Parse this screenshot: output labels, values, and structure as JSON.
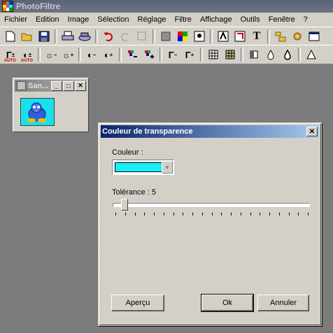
{
  "app": {
    "title": "PhotoFiltre"
  },
  "menu": [
    "Fichier",
    "Edition",
    "Image",
    "Sélection",
    "Réglage",
    "Filtre",
    "Affichage",
    "Outils",
    "Fenêtre",
    "?"
  ],
  "toolbar1": [
    "new-icon",
    "open-icon",
    "save-icon",
    "print-icon",
    "scan-icon",
    "undo-icon",
    "redo-icon",
    "selection-icon",
    "gray-icon",
    "colors-icon",
    "filter-a-icon",
    "filter-b-icon",
    "filter-c-icon",
    "text-icon",
    "explorer-icon",
    "gear-icon",
    "window-icon"
  ],
  "toolbar2": {
    "auto_label": "AUTO",
    "icons": [
      "gamma-auto-icon",
      "contrast-auto-icon",
      "brightness-minus-icon",
      "brightness-plus-icon",
      "contrast-minus-icon",
      "contrast-plus-icon",
      "saturation-minus-icon",
      "saturation-plus-icon",
      "gamma-minus-icon",
      "gamma-plus-icon",
      "grid-icon",
      "grid2-icon",
      "fill-icon",
      "drop-icon",
      "drops-icon",
      "sharpen-icon"
    ]
  },
  "image_window": {
    "title": "San..."
  },
  "dialog": {
    "title": "Couleur de transparence",
    "color_label": "Couleur :",
    "color_value": "#18f0f8",
    "tolerance_label": "Tolérance : 5",
    "tolerance_value": 5,
    "preview_button": "Aperçu",
    "ok_button": "Ok",
    "cancel_button": "Annuler"
  }
}
